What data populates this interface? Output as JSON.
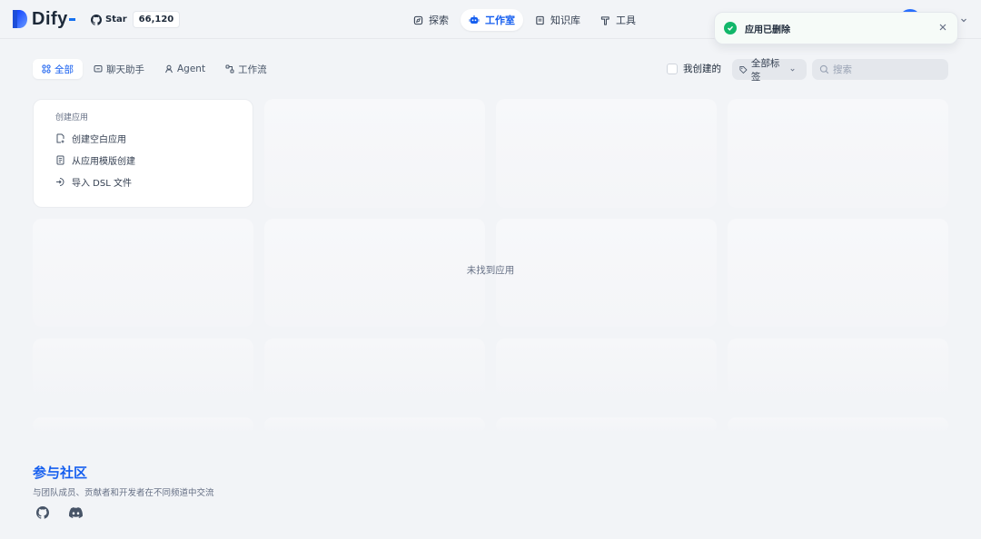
{
  "header": {
    "logo_text": "Dify",
    "github_star_label": "Star",
    "github_star_count": "66,120",
    "nav": [
      {
        "label": "探索",
        "icon": "compass-icon"
      },
      {
        "label": "工作室",
        "icon": "robot-icon"
      },
      {
        "label": "知识库",
        "icon": "book-icon"
      },
      {
        "label": "工具",
        "icon": "hammer-icon"
      }
    ],
    "active_nav": "工作室"
  },
  "toast": {
    "message": "应用已删除",
    "type": "success",
    "close_icon": "close-icon"
  },
  "filters": {
    "tabs": [
      {
        "label": "全部",
        "icon": "grid-icon"
      },
      {
        "label": "聊天助手",
        "icon": "chat-icon"
      },
      {
        "label": "Agent",
        "icon": "agent-icon"
      },
      {
        "label": "工作流",
        "icon": "workflow-icon"
      }
    ],
    "active_tab": "全部",
    "mine_label": "我创建的",
    "tags_label": "全部标签",
    "search_placeholder": "搜索"
  },
  "create_card": {
    "title": "创建应用",
    "items": [
      {
        "label": "创建空白应用",
        "icon": "file-plus-icon"
      },
      {
        "label": "从应用模版创建",
        "icon": "template-icon"
      },
      {
        "label": "导入 DSL 文件",
        "icon": "import-icon"
      }
    ]
  },
  "empty_message": "未找到应用",
  "community": {
    "title": "参与社区",
    "subtitle": "与团队成员、贡献者和开发者在不同频道中交流",
    "icons": [
      "github-icon",
      "discord-icon"
    ]
  },
  "colors": {
    "accent": "#155eef",
    "background": "#f2f4f7",
    "success": "#12b76a"
  }
}
